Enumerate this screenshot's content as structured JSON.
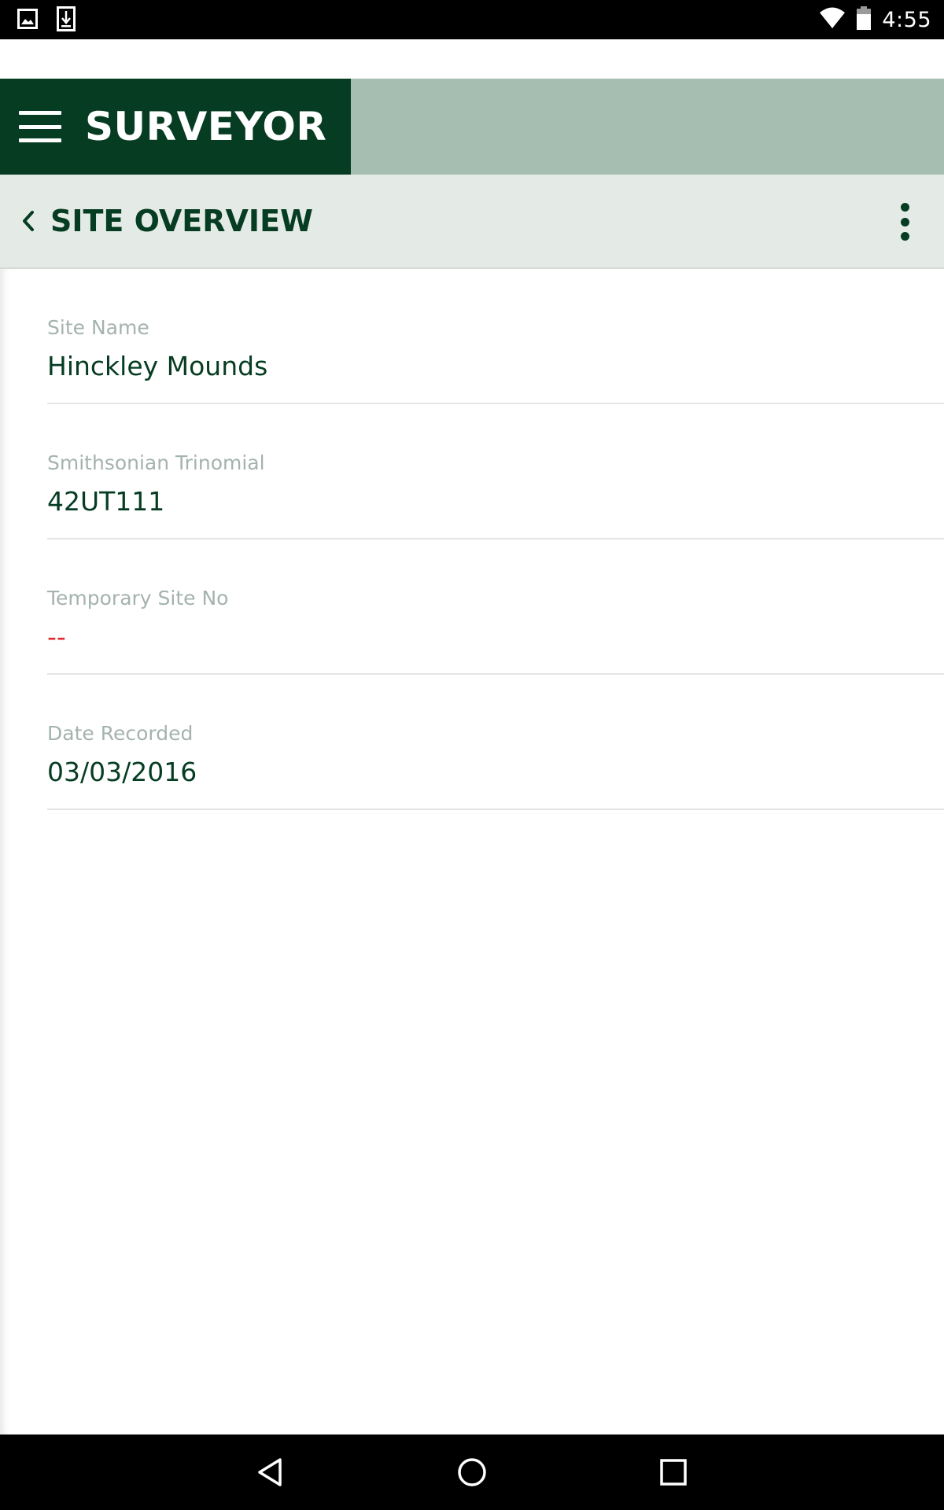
{
  "status_bar": {
    "time": "4:55",
    "left_icons": [
      "gallery-notification-icon",
      "download-notification-icon"
    ],
    "right_icons": [
      "wifi-icon",
      "battery-icon"
    ]
  },
  "app_bar": {
    "title": "SURVEYOR",
    "menu_icon": "hamburger-menu-icon",
    "brand_color": "#063d22",
    "bar_color": "#a6bdb1"
  },
  "sub_header": {
    "title": "SITE OVERVIEW",
    "back_icon": "chevron-left-icon",
    "more_icon": "more-vertical-icon"
  },
  "fields": [
    {
      "label": "Site Name",
      "value": "Hinckley Mounds"
    },
    {
      "label": "Smithsonian Trinomial",
      "value": "42UT111"
    },
    {
      "label": "Temporary Site No",
      "value": "--"
    },
    {
      "label": "Date Recorded",
      "value": "03/03/2016"
    }
  ],
  "nav_bar": {
    "icons": [
      "back-triangle-icon",
      "home-circle-icon",
      "recents-square-icon"
    ]
  }
}
